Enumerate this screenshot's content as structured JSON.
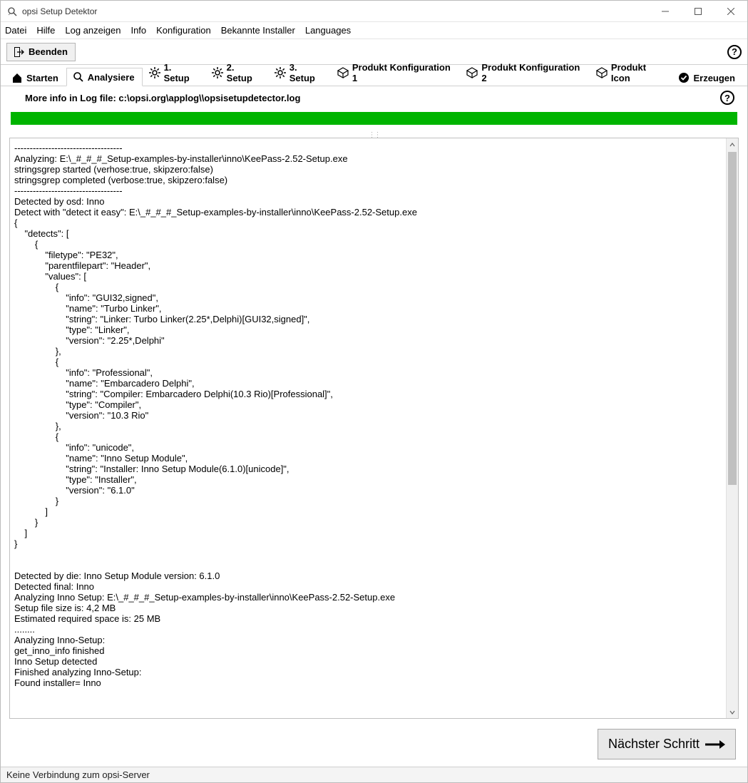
{
  "window": {
    "title": "opsi Setup Detektor"
  },
  "menu": {
    "datei": "Datei",
    "hilfe": "Hilfe",
    "log": "Log anzeigen",
    "info": "Info",
    "konfig": "Konfiguration",
    "bekannte": "Bekannte Installer",
    "lang": "Languages"
  },
  "toolbar": {
    "beenden": "Beenden"
  },
  "tabs": {
    "starten": "Starten",
    "analysiere": "Analysiere",
    "setup1": "1. Setup",
    "setup2": "2. Setup",
    "setup3": "3. Setup",
    "pk1": "Produkt Konfiguration 1",
    "pk2": "Produkt Konfiguration 2",
    "picon": "Produkt Icon",
    "erzeugen": "Erzeugen"
  },
  "info": {
    "text": "More info in Log file: c:\\opsi.org\\applog\\\\opsisetupdetector.log"
  },
  "log": "-----------------------------------\nAnalyzing: E:\\_#_#_#_Setup-examples-by-installer\\inno\\KeePass-2.52-Setup.exe\nstringsgrep started (verhose:true, skipzero:false)\nstringsgrep completed (verbose:true, skipzero:false)\n-----------------------------------\nDetected by osd: Inno\nDetect with \"detect it easy\": E:\\_#_#_#_Setup-examples-by-installer\\inno\\KeePass-2.52-Setup.exe\n{\n    \"detects\": [\n        {\n            \"filetype\": \"PE32\",\n            \"parentfilepart\": \"Header\",\n            \"values\": [\n                {\n                    \"info\": \"GUI32,signed\",\n                    \"name\": \"Turbo Linker\",\n                    \"string\": \"Linker: Turbo Linker(2.25*,Delphi)[GUI32,signed]\",\n                    \"type\": \"Linker\",\n                    \"version\": \"2.25*,Delphi\"\n                },\n                {\n                    \"info\": \"Professional\",\n                    \"name\": \"Embarcadero Delphi\",\n                    \"string\": \"Compiler: Embarcadero Delphi(10.3 Rio)[Professional]\",\n                    \"type\": \"Compiler\",\n                    \"version\": \"10.3 Rio\"\n                },\n                {\n                    \"info\": \"unicode\",\n                    \"name\": \"Inno Setup Module\",\n                    \"string\": \"Installer: Inno Setup Module(6.1.0)[unicode]\",\n                    \"type\": \"Installer\",\n                    \"version\": \"6.1.0\"\n                }\n            ]\n        }\n    ]\n}\n\n\nDetected by die: Inno Setup Module version: 6.1.0\nDetected final: Inno\nAnalyzing Inno Setup: E:\\_#_#_#_Setup-examples-by-installer\\inno\\KeePass-2.52-Setup.exe\nSetup file size is: 4,2 MB\nEstimated required space is: 25 MB\n........\nAnalyzing Inno-Setup:\nget_inno_info finished\nInno Setup detected\nFinished analyzing Inno-Setup:\nFound installer= Inno",
  "next": {
    "label": "Nächster Schritt"
  },
  "status": {
    "text": "Keine Verbindung zum opsi-Server"
  }
}
